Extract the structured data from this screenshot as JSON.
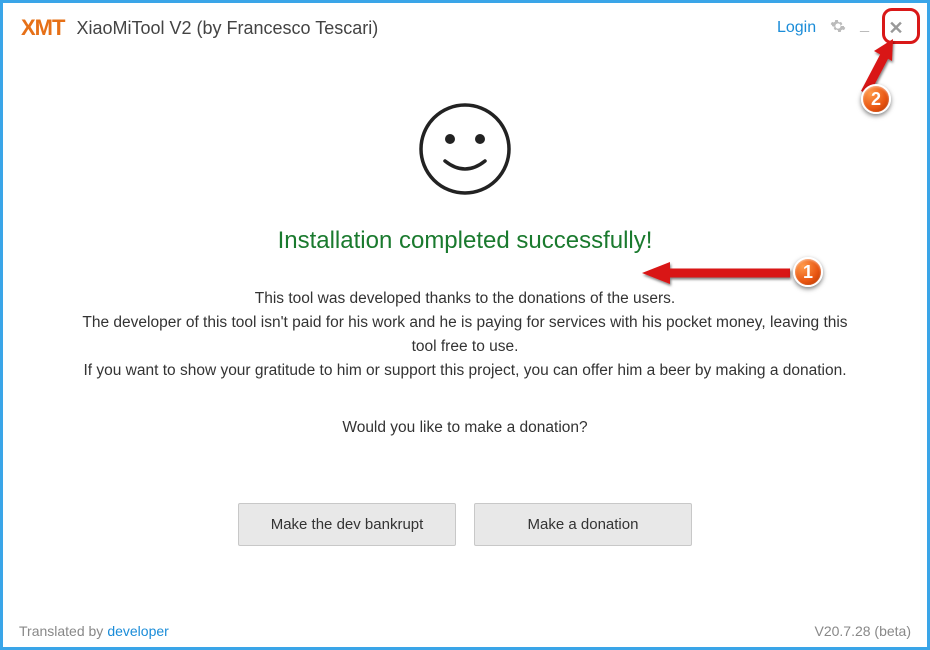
{
  "header": {
    "logo_text": "XMT",
    "title": "XiaoMiTool V2 (by Francesco Tescari)",
    "login_label": "Login"
  },
  "main": {
    "success_message": "Installation completed successfully!",
    "line1": "This tool was developed thanks to the donations of the users.",
    "line2": "The developer of this tool isn't paid for his work and he is paying for services with his pocket money, leaving this tool free to use.",
    "line3": "If you want to show your gratitude to him or support this project, you can offer him a beer by making a donation.",
    "donation_question": "Would you like to make a donation?",
    "button_bankrupt": "Make the dev bankrupt",
    "button_donate": "Make a donation"
  },
  "footer": {
    "translated_by_label": "Translated by",
    "translator": "developer",
    "version": "V20.7.28 (beta)"
  },
  "annotations": {
    "badge1": "1",
    "badge2": "2"
  }
}
